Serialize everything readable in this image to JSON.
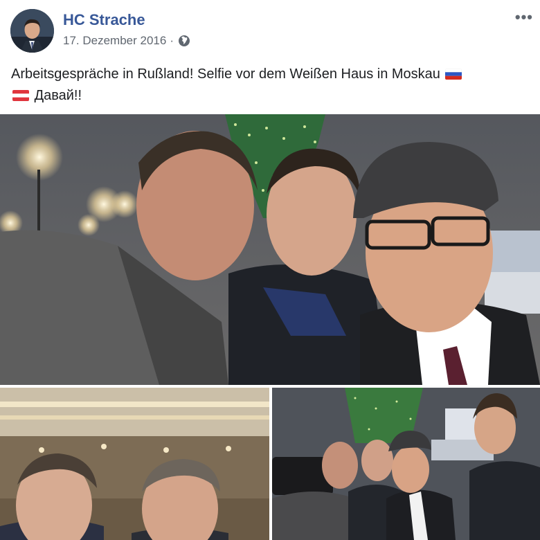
{
  "post": {
    "author": "HC Strache",
    "date": "17. Dezember 2016",
    "separator": "·",
    "privacy_icon": "globe-icon",
    "more_label": "•••",
    "text_line1": "Arbeitsgespräche in Rußland! Selfie vor dem Weißen Haus in Moskau",
    "text_line2": "Давай!!"
  },
  "flags": [
    "russia-flag-icon",
    "austria-flag-icon"
  ],
  "colors": {
    "author_link": "#385898",
    "meta_gray": "#606770",
    "text": "#1c1e21"
  }
}
